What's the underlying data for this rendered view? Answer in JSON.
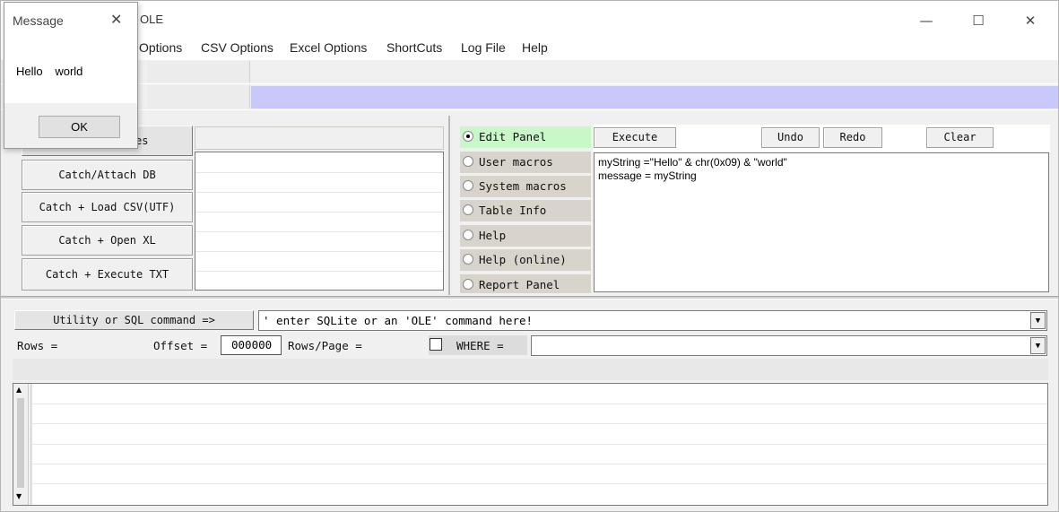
{
  "window": {
    "title": "OLE",
    "minimize": "—",
    "maximize": "☐",
    "close": "✕"
  },
  "menu": [
    "Options",
    "CSV Options",
    "Excel Options",
    "ShortCuts",
    "Log File",
    "Help"
  ],
  "left_panel": {
    "partial_button": "es",
    "buttons": [
      "Catch/Attach DB",
      "Catch + Load CSV(UTF)",
      "Catch + Open XL",
      "Catch + Execute TXT"
    ]
  },
  "radio_panel": {
    "items": [
      "Edit Panel",
      "User macros",
      "System macros",
      "Table Info",
      "Help",
      "Help (online)",
      "Report Panel"
    ],
    "active_index": 0
  },
  "editor": {
    "execute": "Execute",
    "undo": "Undo",
    "redo": "Redo",
    "clear": "Clear",
    "lines": [
      "myString =\"Hello\" & chr(0x09) & \"world\"",
      "message = myString"
    ]
  },
  "command_bar": {
    "button": "Utility or SQL command  =>",
    "value": "' enter SQLite or an 'OLE' command here!"
  },
  "query_bar": {
    "rows_label": "Rows =",
    "offset_label": "Offset =",
    "offset_value": "000000",
    "rows_per_page_label": "Rows/Page =",
    "where_label": "WHERE ="
  },
  "dialog": {
    "title": "Message",
    "message": "Hello\tworld",
    "ok": "OK"
  },
  "colors": {
    "active_radio": "#c8f7c8",
    "highlight_bar": "#c8c8fa"
  }
}
